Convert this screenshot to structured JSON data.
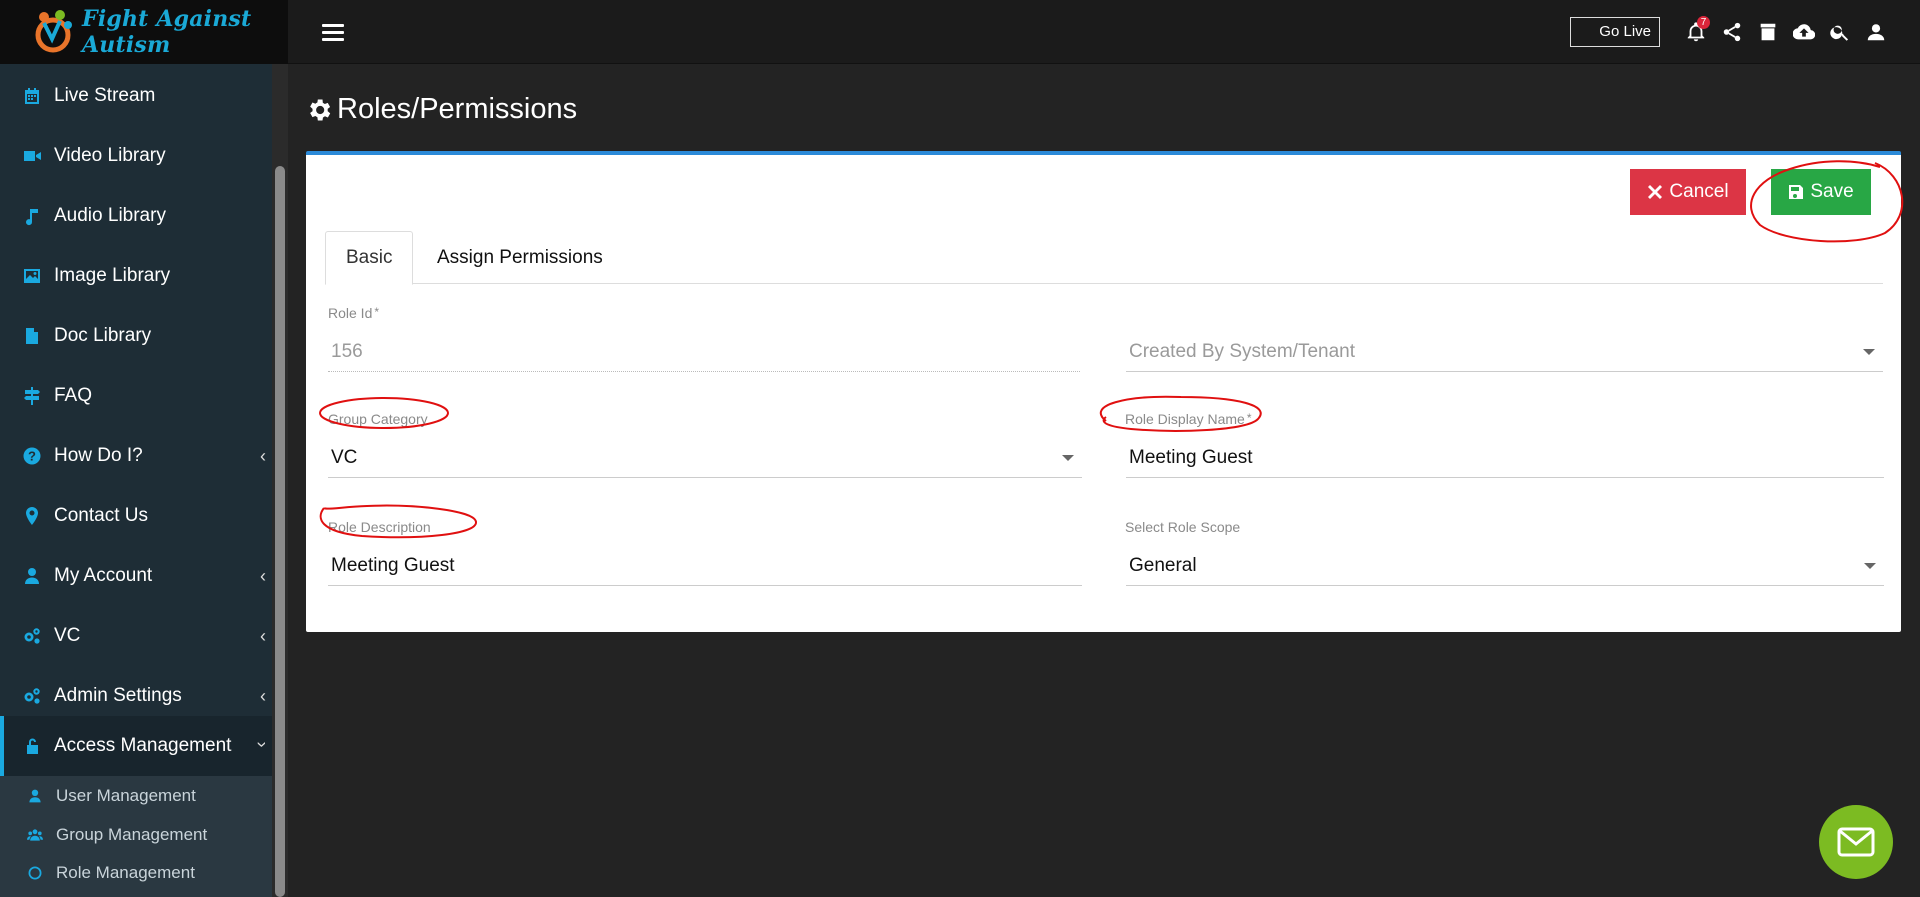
{
  "brand": {
    "logo_text": "Fight Against Autism"
  },
  "topbar": {
    "go_live_label": "Go Live",
    "notification_count": "7",
    "icons": [
      "menu-icon",
      "bell-icon",
      "share-icon",
      "archive-icon",
      "cloud-upload-icon",
      "search-icon",
      "user-icon"
    ]
  },
  "sidebar": {
    "items": [
      {
        "label": "Live Stream",
        "icon": "calendar-icon"
      },
      {
        "label": "Video Library",
        "icon": "video-icon"
      },
      {
        "label": "Audio Library",
        "icon": "music-icon"
      },
      {
        "label": "Image Library",
        "icon": "image-icon"
      },
      {
        "label": "Doc Library",
        "icon": "document-icon"
      },
      {
        "label": "FAQ",
        "icon": "signpost-icon"
      },
      {
        "label": "How Do I?",
        "icon": "question-icon"
      },
      {
        "label": "Contact Us",
        "icon": "map-marker-icon"
      },
      {
        "label": "My Account",
        "icon": "user-icon"
      },
      {
        "label": "VC",
        "icon": "cogs-icon"
      },
      {
        "label": "Admin Settings",
        "icon": "cogs-icon"
      },
      {
        "label": "Access Management",
        "icon": "unlock-icon"
      }
    ],
    "sub_items": [
      {
        "label": "User Management",
        "icon": "user-icon"
      },
      {
        "label": "Group Management",
        "icon": "users-icon"
      },
      {
        "label": "Role Management",
        "icon": "circle-icon"
      }
    ]
  },
  "page": {
    "title": "Roles/Permissions"
  },
  "actions": {
    "cancel_label": "Cancel",
    "save_label": "Save"
  },
  "tabs": [
    {
      "label": "Basic",
      "active": true
    },
    {
      "label": "Assign Permissions",
      "active": false
    }
  ],
  "form": {
    "role_id": {
      "label": "Role Id",
      "value": "156"
    },
    "created_by": {
      "placeholder": "Created By System/Tenant"
    },
    "group_category": {
      "label": "Group Category",
      "value": "VC"
    },
    "role_display_name": {
      "label": "Role Display Name",
      "value": "Meeting Guest"
    },
    "role_description": {
      "label": "Role Description",
      "value": "Meeting Guest"
    },
    "role_scope": {
      "label": "Select Role Scope",
      "value": "General"
    },
    "required_mark": "*"
  },
  "colors": {
    "accent": "#1aa9e0",
    "cancel": "#dc3545",
    "save": "#28a745",
    "card_top_border": "#2b8ad8",
    "fab": "#7cbb22",
    "annotation": "#e01010"
  }
}
